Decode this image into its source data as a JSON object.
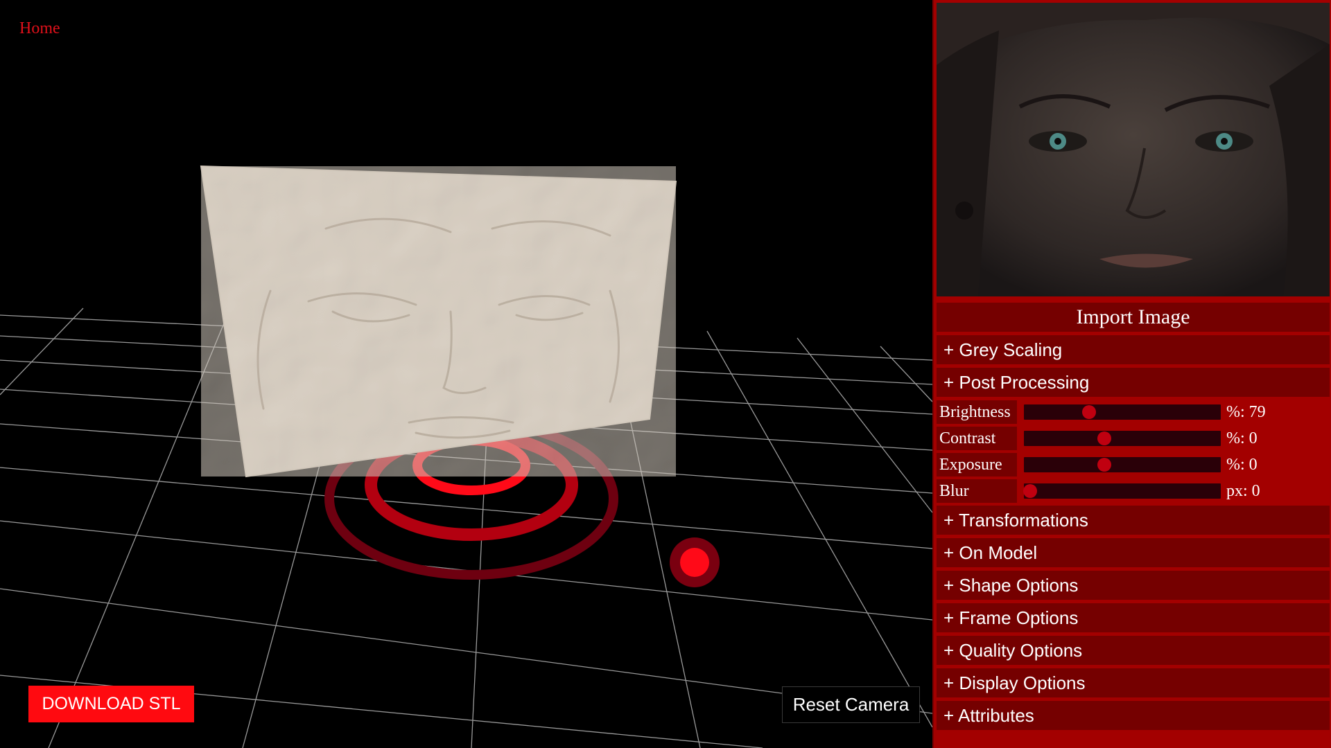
{
  "nav": {
    "home_label": "Home"
  },
  "viewport": {
    "download_label": "DOWNLOAD STL",
    "reset_camera_label": "Reset Camera"
  },
  "panel": {
    "import_label": "Import Image",
    "sections_top": [
      {
        "label": "+ Grey Scaling"
      },
      {
        "label": "+ Post Processing"
      }
    ],
    "sliders": [
      {
        "label": "Brightness",
        "unit": "%:",
        "value": "79",
        "level": 0.33
      },
      {
        "label": "Contrast",
        "unit": "%:",
        "value": "0",
        "level": 0.41
      },
      {
        "label": "Exposure",
        "unit": "%:",
        "value": "0",
        "level": 0.41
      },
      {
        "label": "Blur",
        "unit": "px:",
        "value": "0",
        "level": 0.03
      }
    ],
    "sections_bottom": [
      {
        "label": "+ Transformations"
      },
      {
        "label": "+ On Model"
      },
      {
        "label": "+ Shape Options"
      },
      {
        "label": "+ Frame Options"
      },
      {
        "label": "+ Quality Options"
      },
      {
        "label": "+ Display Options"
      },
      {
        "label": "+ Attributes"
      }
    ]
  },
  "colors": {
    "accent": "#ff0a10",
    "panel_bg": "#a30000",
    "row_bg": "#750000",
    "relief": "#d9cfc2"
  }
}
